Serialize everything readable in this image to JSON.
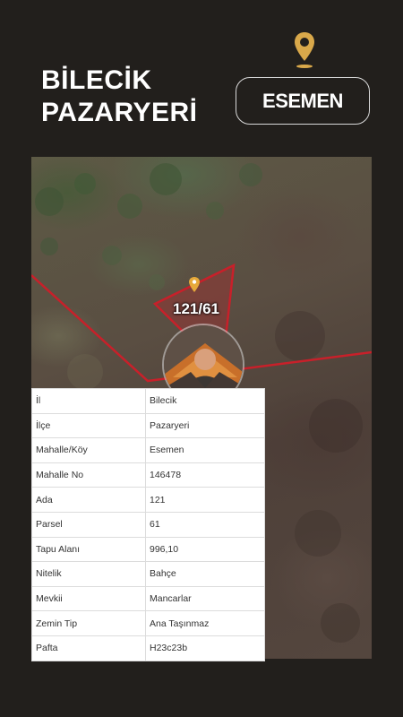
{
  "header": {
    "title_line1": "BİLECİK",
    "title_line2": "PAZARYERİ",
    "location_button": "ESEMEN",
    "pin_icon": "location-pin-icon",
    "pin_color": "#d9a84a"
  },
  "map": {
    "parcel_label": "121/61",
    "boundary_color": "#c8202a"
  },
  "info": [
    {
      "key": "İl",
      "value": "Bilecik"
    },
    {
      "key": "İlçe",
      "value": "Pazaryeri"
    },
    {
      "key": "Mahalle/Köy",
      "value": "Esemen"
    },
    {
      "key": "Mahalle No",
      "value": "146478"
    },
    {
      "key": "Ada",
      "value": "121"
    },
    {
      "key": "Parsel",
      "value": "61"
    },
    {
      "key": "Tapu Alanı",
      "value": "996,10"
    },
    {
      "key": "Nitelik",
      "value": "Bahçe"
    },
    {
      "key": "Mevkii",
      "value": "Mancarlar"
    },
    {
      "key": "Zemin Tip",
      "value": "Ana Taşınmaz"
    },
    {
      "key": "Pafta",
      "value": "H23c23b"
    }
  ]
}
